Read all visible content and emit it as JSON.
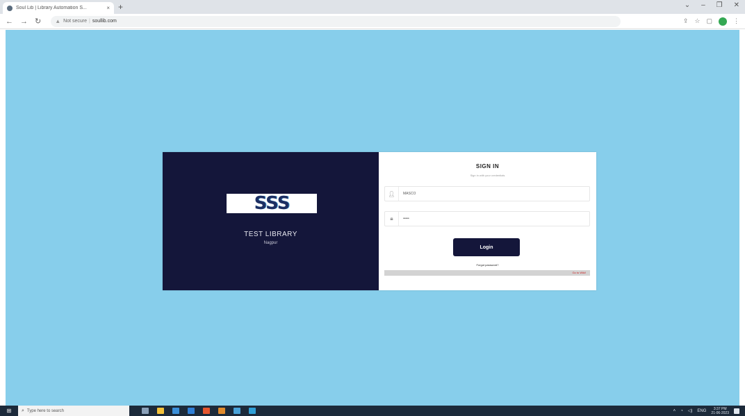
{
  "browser": {
    "tab_title": "Soul Lib | Library Automation S...",
    "tab_close": "×",
    "new_tab": "+",
    "window_controls": [
      "⌄",
      "–",
      "❐",
      "✕"
    ],
    "nav": {
      "back": "←",
      "forward": "→",
      "reload": "↻"
    },
    "address": {
      "security": "Not secure",
      "host": "soullib.com"
    },
    "toolbar_icons": [
      "share-icon",
      "star-icon",
      "sidebar-icon",
      "profile-icon",
      "menu-icon"
    ]
  },
  "login_card": {
    "library_name": "TEST LIBRARY",
    "library_city": "Nagpur",
    "logo_text": "SSS",
    "title": "SIGN IN",
    "subtitle": "Sign in with your credentials",
    "username": {
      "value": "MASCO",
      "icon": "user-icon"
    },
    "password": {
      "value": "•••••",
      "icon": "lock-icon"
    },
    "login_label": "Login",
    "forgot_label": "Forgot password?",
    "message": "Go to Wiki!"
  },
  "taskbar": {
    "search_placeholder": "Type here to search",
    "time": "3:37 PM",
    "date": "21-06-2023",
    "lang": "ENG",
    "apps": [
      {
        "name": "task-view",
        "color": "#8aa0b8"
      },
      {
        "name": "file-explorer",
        "color": "#f3c13a"
      },
      {
        "name": "store",
        "color": "#3b8fd9"
      },
      {
        "name": "mail",
        "color": "#2f7fd6"
      },
      {
        "name": "app-red",
        "color": "#e6562e"
      },
      {
        "name": "app-orange",
        "color": "#e08a2b"
      },
      {
        "name": "chrome",
        "color": "#4aa3d9"
      },
      {
        "name": "edge",
        "color": "#2f9fd6"
      }
    ]
  },
  "colors": {
    "page_bg": "#87ceeb",
    "card_dark": "#14163a",
    "message_text": "#cc2222"
  }
}
